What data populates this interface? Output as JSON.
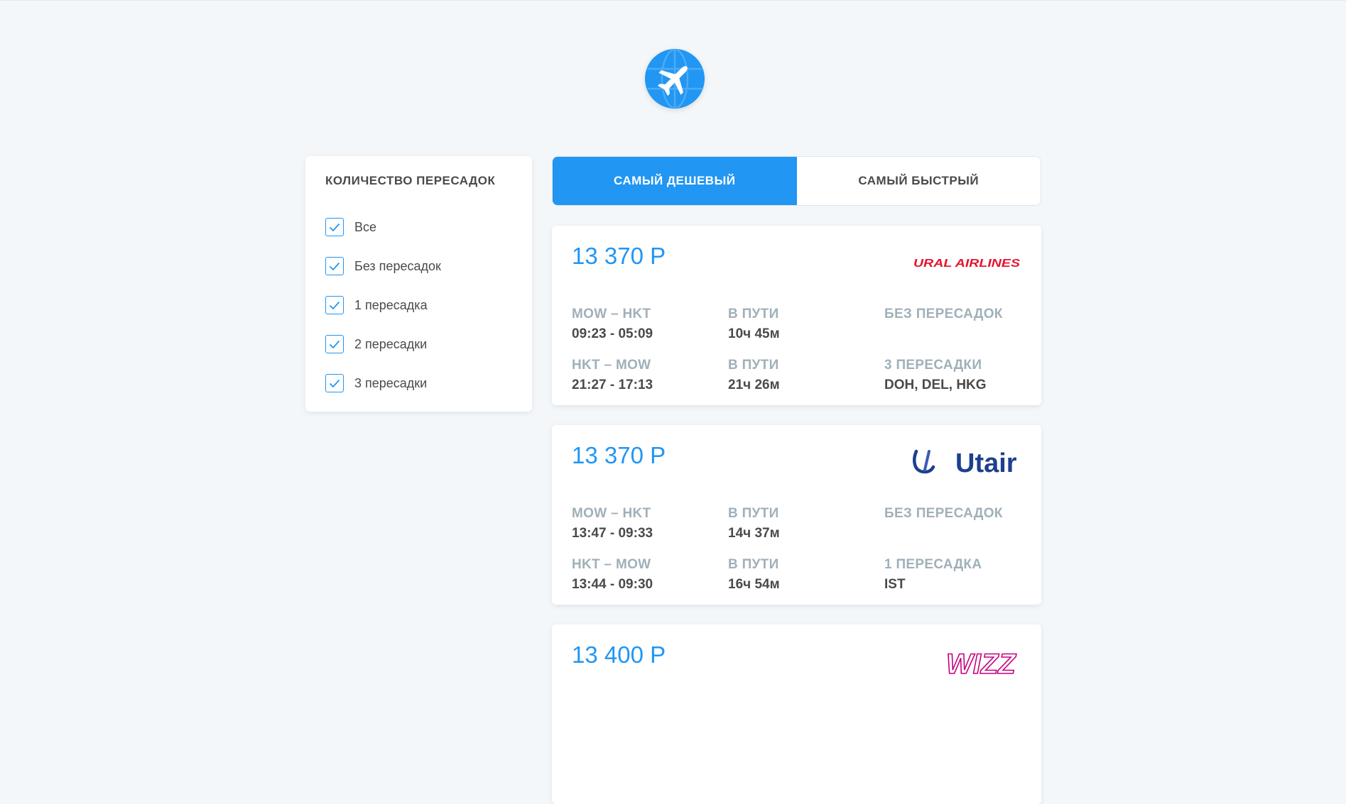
{
  "logo": {
    "icon": "plane-globe-icon",
    "color": "#2196F3"
  },
  "filters": {
    "title": "КОЛИЧЕСТВО ПЕРЕСАДОК",
    "items": [
      {
        "label": "Все",
        "checked": true
      },
      {
        "label": "Без пересадок",
        "checked": true
      },
      {
        "label": "1 пересадка",
        "checked": true
      },
      {
        "label": "2 пересадки",
        "checked": true
      },
      {
        "label": "3 пересадки",
        "checked": true
      }
    ]
  },
  "tabs": [
    {
      "label": "САМЫЙ ДЕШЕВЫЙ",
      "active": true
    },
    {
      "label": "САМЫЙ БЫСТРЫЙ",
      "active": false
    }
  ],
  "accent_color": "#2196F3",
  "tickets": [
    {
      "price": "13 370 Р",
      "carrier": {
        "name": "URAL AIRLINES",
        "icon": "ural-airlines-logo",
        "color": "#E3172E"
      },
      "segments": [
        {
          "route": "MOW – HKT",
          "time": "09:23 - 05:09",
          "duration_label": "В ПУТИ",
          "duration": "10ч 45м",
          "stops_label": "БЕЗ ПЕРЕСАДОК",
          "stops": ""
        },
        {
          "route": "HKT – MOW",
          "time": "21:27 - 17:13",
          "duration_label": "В ПУТИ",
          "duration": "21ч 26м",
          "stops_label": "3 ПЕРЕСАДКИ",
          "stops": "DOH, DEL, HKG"
        }
      ]
    },
    {
      "price": "13 370 Р",
      "carrier": {
        "name": "Utair",
        "icon": "utair-logo",
        "color": "#1E3F8F"
      },
      "segments": [
        {
          "route": "MOW – HKT",
          "time": "13:47 - 09:33",
          "duration_label": "В ПУТИ",
          "duration": "14ч 37м",
          "stops_label": "БЕЗ ПЕРЕСАДОК",
          "stops": ""
        },
        {
          "route": "HKT – MOW",
          "time": "13:44 - 09:30",
          "duration_label": "В ПУТИ",
          "duration": "16ч 54м",
          "stops_label": "1 ПЕРЕСАДКА",
          "stops": "IST"
        }
      ]
    },
    {
      "price": "13 400 Р",
      "carrier": {
        "name": "WIZZ",
        "icon": "wizz-logo",
        "color": "#C6007E"
      },
      "segments": []
    }
  ]
}
